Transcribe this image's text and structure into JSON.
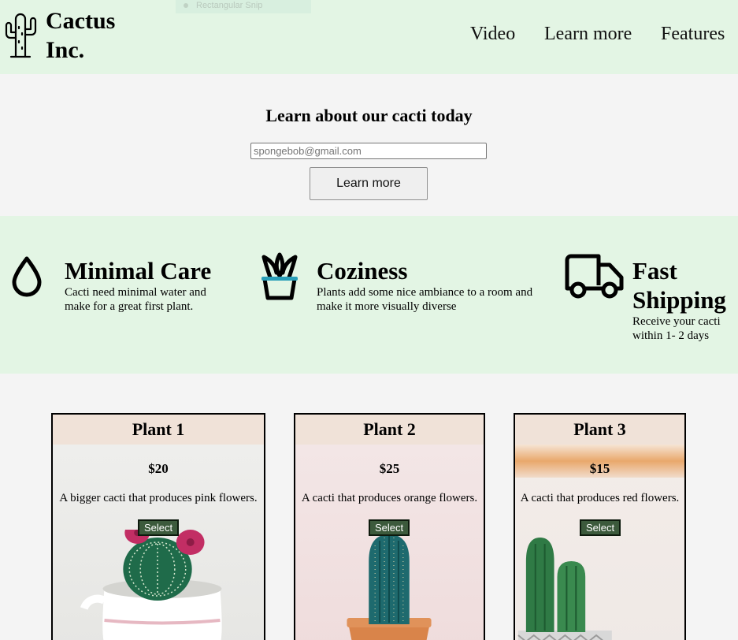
{
  "header": {
    "brand_line1": "Cactus",
    "brand_line2": "Inc.",
    "snip_label": "Rectangular Snip",
    "nav": {
      "video": "Video",
      "learn_more": "Learn more",
      "features": "Features"
    }
  },
  "signup": {
    "title": "Learn about our cacti today",
    "email_value": "spongebob@gmail.com",
    "button_label": "Learn more"
  },
  "features": [
    {
      "icon": "water-drop-icon",
      "title": "Minimal Care",
      "desc": "Cacti need minimal water and make for a great first plant."
    },
    {
      "icon": "potted-plant-icon",
      "title": "Coziness",
      "desc": "Plants add some nice ambiance to a room and make it more visually diverse"
    },
    {
      "icon": "delivery-truck-icon",
      "title_line1": "Fast",
      "title_line2": "Shipping",
      "desc": "Receive your cacti within 1- 2 days"
    }
  ],
  "plants": [
    {
      "name": "Plant 1",
      "price": "$20",
      "desc": "A bigger cacti that produces pink flowers.",
      "button": "Select"
    },
    {
      "name": "Plant 2",
      "price": "$25",
      "desc": "A cacti that produces orange flowers.",
      "button": "Select"
    },
    {
      "name": "Plant 3",
      "price": "$15",
      "desc": "A cacti that produces red flowers.",
      "button": "Select"
    }
  ],
  "colors": {
    "header_bg": "#e3f5e4",
    "page_bg": "#f4f4f4",
    "card_head_bg": "#f0e2d8",
    "select_btn_bg": "#3c5a3c",
    "accent_teal": "#2a9fb8"
  }
}
